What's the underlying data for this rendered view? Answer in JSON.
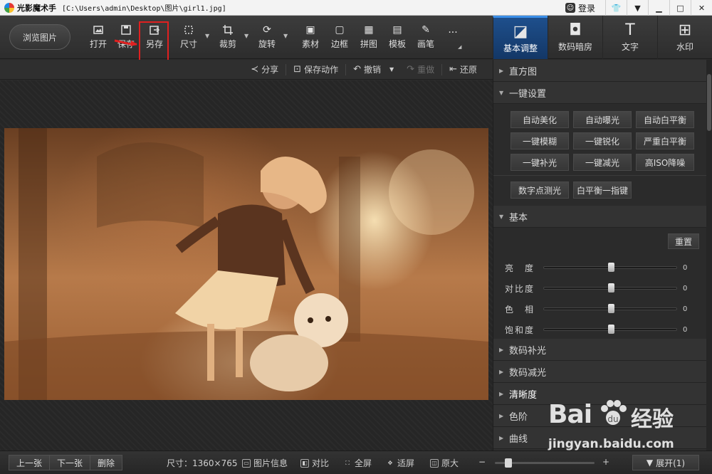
{
  "titlebar": {
    "app_name": "光影魔术手",
    "file_path": "[C:\\Users\\admin\\Desktop\\图片\\girl1.jpg]",
    "login_label": "登录"
  },
  "toolbar": {
    "browse_label": "浏览图片",
    "tools": [
      {
        "label": "打开",
        "icon": "open-image-icon"
      },
      {
        "label": "保存",
        "icon": "save-icon"
      },
      {
        "label": "另存",
        "icon": "save-as-icon"
      },
      {
        "label": "尺寸",
        "icon": "resize-icon"
      },
      {
        "label": "裁剪",
        "icon": "crop-icon"
      },
      {
        "label": "旋转",
        "icon": "rotate-icon"
      },
      {
        "label": "素材",
        "icon": "material-icon"
      },
      {
        "label": "边框",
        "icon": "border-icon"
      },
      {
        "label": "拼图",
        "icon": "collage-icon"
      },
      {
        "label": "模板",
        "icon": "template-icon"
      },
      {
        "label": "画笔",
        "icon": "brush-icon"
      }
    ],
    "more_label": "..."
  },
  "subbar": {
    "share": "分享",
    "save_action": "保存动作",
    "undo": "撤销",
    "redo": "重做",
    "restore": "还原"
  },
  "right_tabs": [
    {
      "label": "基本调整",
      "icon": "basic-adjust-icon",
      "active": true
    },
    {
      "label": "数码暗房",
      "icon": "darkroom-icon",
      "active": false
    },
    {
      "label": "文字",
      "icon": "text-icon",
      "active": false
    },
    {
      "label": "水印",
      "icon": "watermark-icon",
      "active": false
    }
  ],
  "panel": {
    "histogram": "直方图",
    "one_click": "一键设置",
    "one_click_buttons": [
      "自动美化",
      "自动曝光",
      "自动白平衡",
      "一键模糊",
      "一键锐化",
      "严重白平衡",
      "一键补光",
      "一键减光",
      "高ISO降噪"
    ],
    "extra_buttons": [
      "数字点测光",
      "白平衡一指键"
    ],
    "basic": "基本",
    "reset": "重置",
    "sliders": [
      {
        "label": "亮　度",
        "value": "0"
      },
      {
        "label": "对比度",
        "value": "0"
      },
      {
        "label": "色　相",
        "value": "0"
      },
      {
        "label": "饱和度",
        "value": "0"
      }
    ],
    "sections": [
      "数码补光",
      "数码减光",
      "清晰度",
      "色阶",
      "曲线"
    ]
  },
  "bottombar": {
    "prev": "上一张",
    "next": "下一张",
    "delete": "删除",
    "size": "尺寸：1360×765",
    "info": "图片信息",
    "compare": "对比",
    "fullscreen": "全屏",
    "fit": "适屏",
    "original": "原大",
    "zoom_minus": "−",
    "zoom_plus": "+",
    "expand": "展开(1)"
  },
  "watermark": {
    "logo": "Bai",
    "logo_tail": "经验",
    "url": "jingyan.baidu.com"
  },
  "colors": {
    "accent": "#1e4f8c",
    "highlight_box": "#e02020",
    "photo_tone": "#b77a4a"
  }
}
